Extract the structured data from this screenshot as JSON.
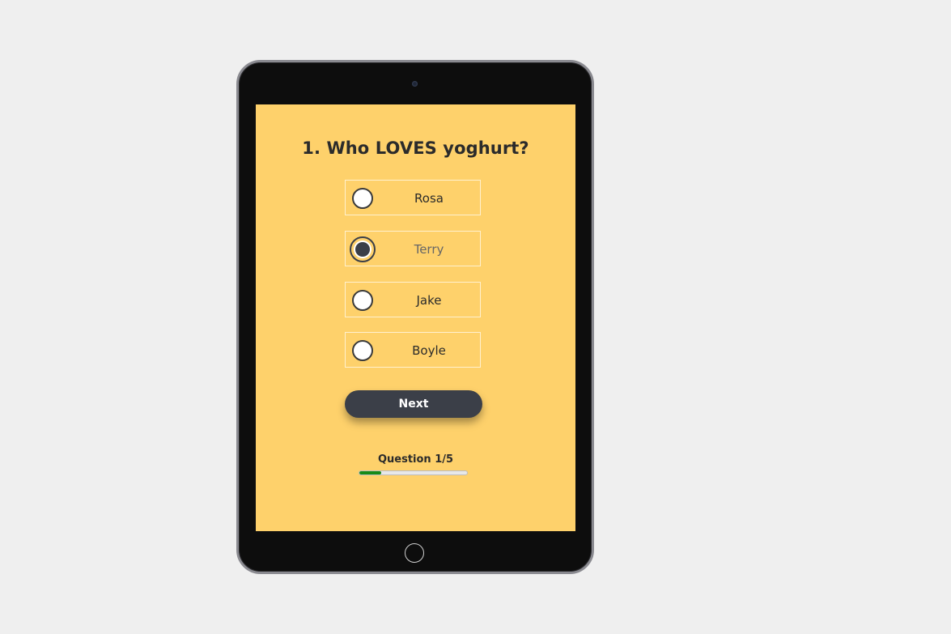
{
  "quiz": {
    "question_title": "1. Who LOVES yoghurt?",
    "options": [
      {
        "label": "Rosa",
        "selected": false
      },
      {
        "label": "Terry",
        "selected": true
      },
      {
        "label": "Jake",
        "selected": false
      },
      {
        "label": "Boyle",
        "selected": false
      }
    ],
    "next_label": "Next",
    "progress": {
      "label": "Question 1/5",
      "current": 1,
      "total": 5
    }
  },
  "colors": {
    "screen_background": "#fed16b",
    "button": "#3b3f48",
    "progress_fill": "#178a17"
  },
  "icons": {
    "radio_unchecked": "radio-unchecked-icon",
    "radio_checked": "radio-checked-icon"
  }
}
